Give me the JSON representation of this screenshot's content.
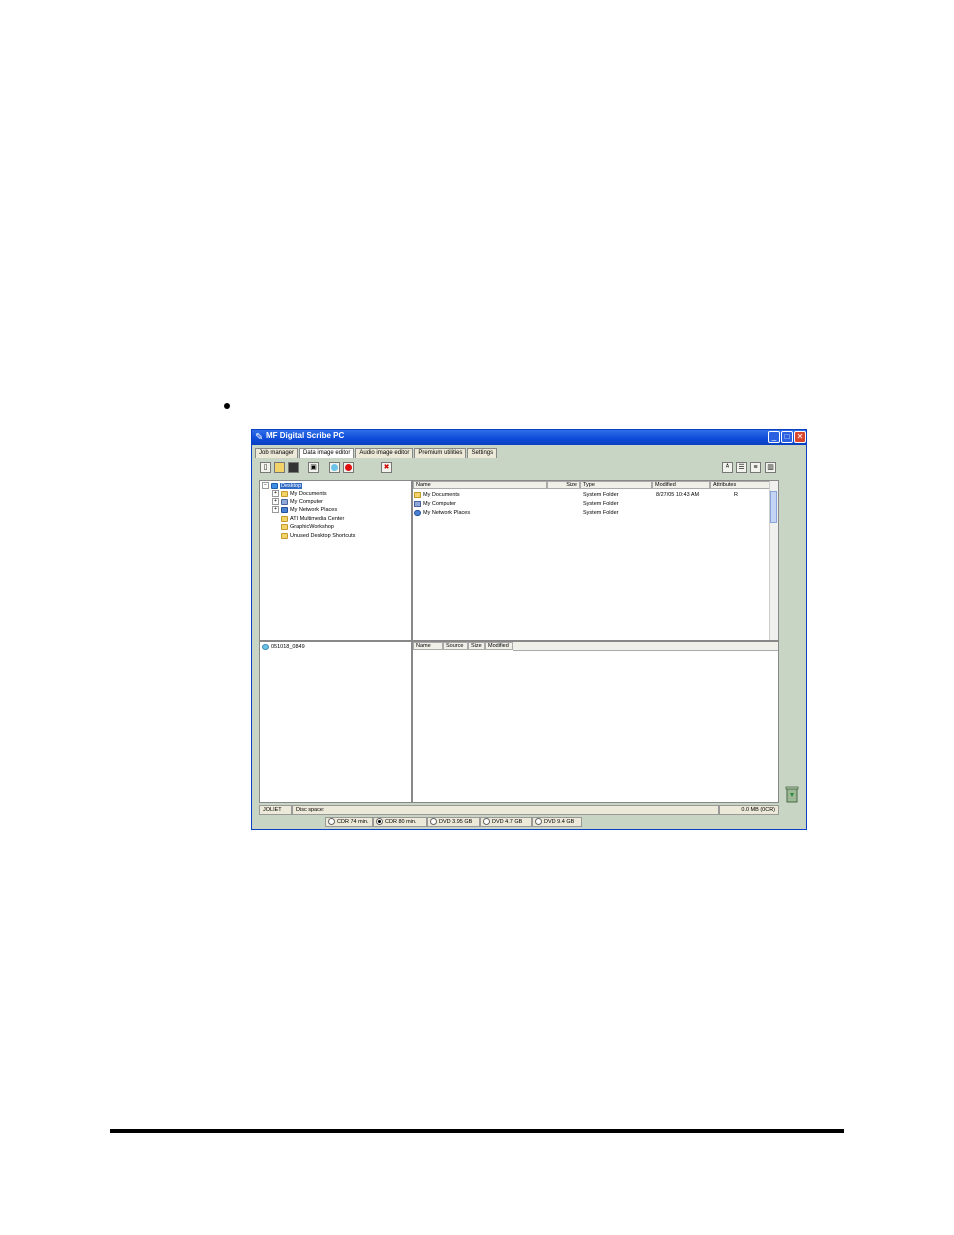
{
  "window": {
    "title": "MF Digital Scribe PC"
  },
  "tabs": [
    "Job manager",
    "Data image editor",
    "Audio image editor",
    "Premium utilities",
    "Settings"
  ],
  "tree": {
    "root": "Desktop",
    "items": [
      "My Documents",
      "My Computer",
      "My Network Places",
      "ATI Multimedia Center",
      "GraphicWorkshop",
      "Unused Desktop Shortcuts"
    ]
  },
  "files": {
    "columns": {
      "name": "Name",
      "size": "Size",
      "type": "Type",
      "modified": "Modified",
      "attributes": "Attributes"
    },
    "rows": [
      {
        "name": "My Documents",
        "size": "",
        "type": "System Folder",
        "modified": "8/27/05 10:43 AM",
        "attributes": "R"
      },
      {
        "name": "My Computer",
        "size": "",
        "type": "System Folder",
        "modified": "",
        "attributes": ""
      },
      {
        "name": "My Network Places",
        "size": "",
        "type": "System Folder",
        "modified": "",
        "attributes": ""
      }
    ]
  },
  "disc": {
    "label": "051018_0849"
  },
  "image_columns": {
    "name": "Name",
    "source": "Source",
    "size": "Size",
    "modified": "Modified"
  },
  "status": {
    "filesystem": "JOLIET",
    "disc_space_label": "Disc space:",
    "size": "0.0 MB (0CR)"
  },
  "media_options": [
    {
      "label": "CDR 74 min.",
      "selected": false
    },
    {
      "label": "CDR 80 min.",
      "selected": true
    },
    {
      "label": "DVD 3.95 GB",
      "selected": false
    },
    {
      "label": "DVD 4.7 GB",
      "selected": false
    },
    {
      "label": "DVD 9.4 GB",
      "selected": false
    }
  ],
  "colors": {
    "titlebar": "#0c4ad8",
    "window_bg": "#c8d4c4",
    "selection": "#316ac5"
  }
}
